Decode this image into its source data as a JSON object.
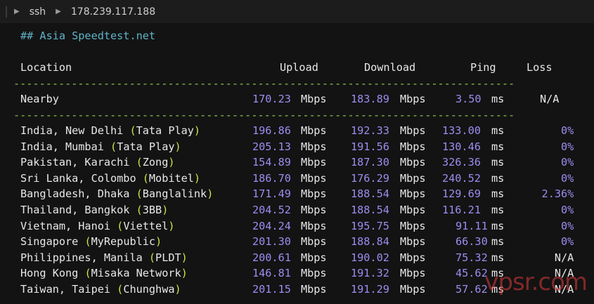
{
  "breadcrumb": {
    "segments": [
      "ssh",
      "178.239.117.188"
    ]
  },
  "terminal": {
    "heading": "## Asia Speedtest.net",
    "headers": {
      "location": "Location",
      "upload": "Upload",
      "download": "Download",
      "ping": "Ping",
      "loss": "Loss"
    },
    "separator": "------------------------------------------------------------------------------",
    "nearby": {
      "location": "Nearby",
      "upload": "170.23",
      "upload_unit": "Mbps",
      "download": "183.89",
      "download_unit": "Mbps",
      "ping": "3.50",
      "ping_unit": "ms",
      "loss": "N/A"
    },
    "rows": [
      {
        "place": "India, New Delhi",
        "isp": "Tata Play",
        "upload": "196.86",
        "download": "192.33",
        "ping": "133.00",
        "loss": "0%"
      },
      {
        "place": "India, Mumbai",
        "isp": "Tata Play",
        "upload": "205.13",
        "download": "191.56",
        "ping": "130.46",
        "loss": "0%"
      },
      {
        "place": "Pakistan, Karachi",
        "isp": "Zong",
        "upload": "154.89",
        "download": "187.30",
        "ping": "326.36",
        "loss": "0%"
      },
      {
        "place": "Sri Lanka, Colombo",
        "isp": "Mobitel",
        "upload": "186.70",
        "download": "176.29",
        "ping": "240.52",
        "loss": "0%"
      },
      {
        "place": "Bangladesh, Dhaka",
        "isp": "Banglalink",
        "upload": "171.49",
        "download": "188.54",
        "ping": "129.69",
        "loss": "2.36%"
      },
      {
        "place": "Thailand, Bangkok",
        "isp": "3BB",
        "upload": "204.52",
        "download": "188.54",
        "ping": "116.21",
        "loss": "0%"
      },
      {
        "place": "Vietnam, Hanoi",
        "isp": "Viettel",
        "upload": "204.24",
        "download": "195.75",
        "ping": "91.11",
        "loss": "0%"
      },
      {
        "place": "Singapore",
        "isp": "MyRepublic",
        "upload": "201.30",
        "download": "188.84",
        "ping": "66.30",
        "loss": "0%"
      },
      {
        "place": "Philippines, Manila",
        "isp": "PLDT",
        "upload": "200.61",
        "download": "190.02",
        "ping": "75.32",
        "loss": "N/A"
      },
      {
        "place": "Hong Kong",
        "isp": "Misaka Network",
        "upload": "146.81",
        "download": "191.32",
        "ping": "45.62",
        "loss": "N/A"
      },
      {
        "place": "Taiwan, Taipei",
        "isp": "Chunghwa",
        "upload": "201.15",
        "download": "191.29",
        "ping": "57.62",
        "loss": "N/A"
      }
    ],
    "units": {
      "speed": "Mbps",
      "ping": "ms"
    }
  },
  "watermark": "vpsr.com",
  "colors": {
    "background": "#131313",
    "number": "#9f8cf0",
    "paren": "#c8e64a",
    "separator": "#8bc34a",
    "heading": "#5fb3c8"
  }
}
